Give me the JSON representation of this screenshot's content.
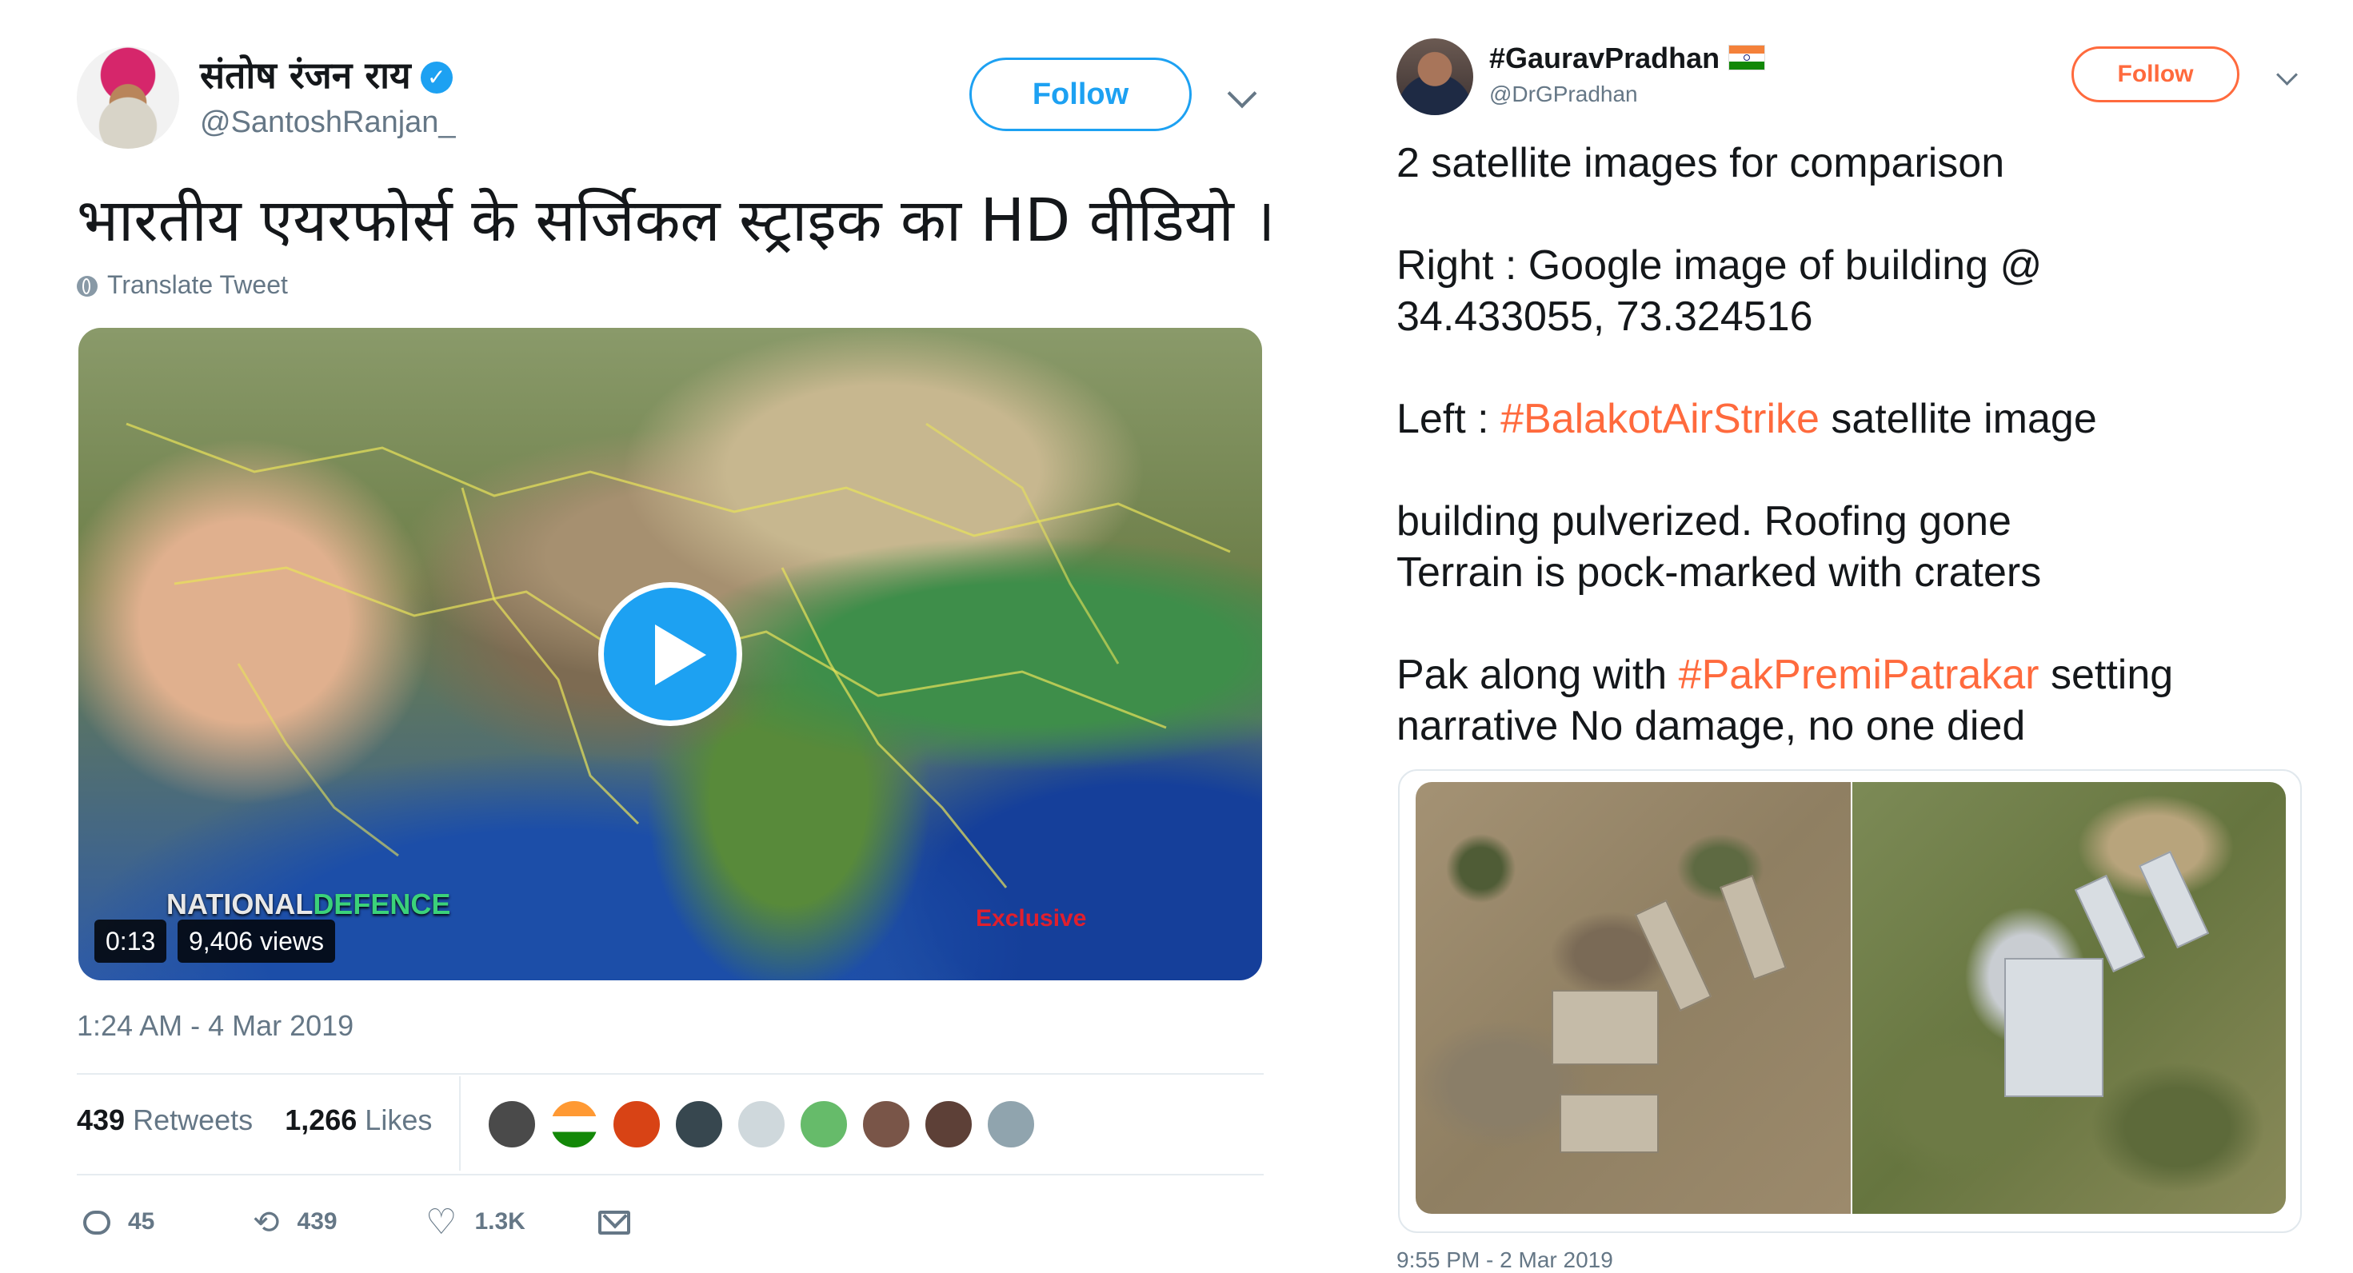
{
  "left_tweet": {
    "display_name": "संतोष रंजन राय",
    "handle": "@SantoshRanjan_",
    "follow_label": "Follow",
    "text": "भारतीय एयरफोर्स के सर्जिकल स्ट्राइक का HD वीडियो ।",
    "translate_label": "Translate Tweet",
    "video": {
      "duration": "0:13",
      "views": "9,406 views",
      "watermark_a": "NATIONAL",
      "watermark_b": "DEFENCE",
      "exclusive_tag": "Exclusive"
    },
    "timestamp": "1:24 AM - 4 Mar 2019",
    "retweets_count": "439",
    "retweets_label": "Retweets",
    "likes_count": "1,266",
    "likes_label": "Likes",
    "likers": [
      "#4a4a4a",
      "#ff9933",
      "#d84315",
      "#37474f",
      "#cfd8dc",
      "#66bb6a",
      "#795548",
      "#5d4037",
      "#90a4ae"
    ],
    "actions": {
      "replies": "45",
      "retweets": "439",
      "likes": "1.3K"
    }
  },
  "right_tweet": {
    "display_name": "#GauravPradhan",
    "handle": "@DrGPradhan",
    "follow_label": "Follow",
    "lines": {
      "l1": "2 satellite images for comparison",
      "l2": "Right : Google image of building @",
      "l3": "34.433055, 73.324516",
      "l4_prefix": "Left : ",
      "l4_hashtag": "#BalakotAirStrike",
      "l4_suffix": " satellite image",
      "l5": "building pulverized. Roofing gone",
      "l6": "Terrain is pock-marked with craters",
      "l7_prefix": "Pak along with ",
      "l7_hashtag": "#PakPremiPatrakar",
      "l7_suffix": " setting",
      "l8": "narrative No damage, no one died"
    },
    "timestamp": "9:55 PM - 2 Mar 2019"
  },
  "colors": {
    "twitter_blue": "#1da1f2",
    "accent_orange": "#ff6a3d",
    "muted_text": "#657786"
  }
}
